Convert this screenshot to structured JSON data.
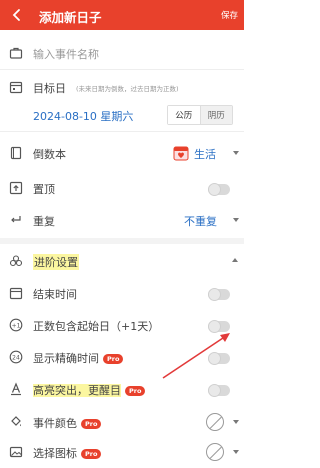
{
  "header": {
    "title": "添加新日子",
    "save_label": "保存"
  },
  "event_name": {
    "placeholder": "输入事件名称"
  },
  "target_date": {
    "label": "目标日",
    "hint": "(未来日期为倒数，过去日期为正数)",
    "date_value": "2024-08-10 星期六",
    "calendar_tabs": [
      "公历",
      "阴历"
    ],
    "selected_tab": "公历"
  },
  "notebook": {
    "label": "倒数本",
    "value": "生活"
  },
  "pin_top": {
    "label": "置顶"
  },
  "repeat": {
    "label": "重复",
    "value": "不重复"
  },
  "advanced": {
    "title": "进阶设置",
    "items": [
      {
        "label": "结束时间",
        "pro": false
      },
      {
        "label": "正数包含起始日（+1天）",
        "pro": false
      },
      {
        "label": "显示精确时间",
        "pro": true,
        "pro_text": "Pro"
      },
      {
        "label": "高亮突出，更醒目",
        "pro": true,
        "pro_text": "Pro"
      },
      {
        "label": "事件颜色",
        "pro": true,
        "pro_text": "Pro"
      },
      {
        "label": "选择图标",
        "pro": true,
        "pro_text": "Pro"
      }
    ]
  },
  "colors": {
    "accent": "#e8412c",
    "date_blue": "#2a6fc4",
    "highlight": "#fbf6a0"
  }
}
